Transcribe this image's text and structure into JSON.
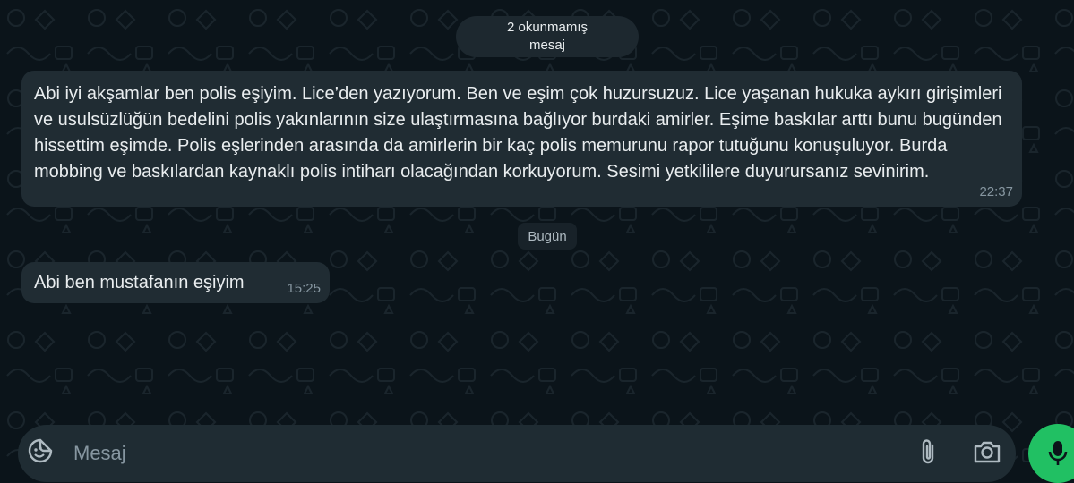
{
  "unread_banner": {
    "line1": "2 okunmamış",
    "line2": "mesaj"
  },
  "messages": [
    {
      "text": "Abi iyi akşamlar ben polis eşiyim. Lice’den yazıyorum. Ben ve eşim çok huzursuzuz. Lice yaşanan hukuka aykırı girişimleri ve usulsüzlüğün bedelini polis yakınlarının size ulaştırmasına bağlıyor burdaki amirler. Eşime baskılar arttı bunu bugünden hissettim eşimde. Polis eşlerinden arasında da amirlerin bir kaç polis memurunu rapor tutuğunu konuşuluyor. Burda mobbing ve baskılardan kaynaklı polis intiharı olacağından korkuyorum. Sesimi yetkililere duyurursanız sevinirim.",
      "time": "22:37"
    },
    {
      "text": "Abi ben mustafanın eşiyim",
      "time": "15:25"
    }
  ],
  "date_separator": "Bugün",
  "composer": {
    "placeholder": "Mesaj"
  },
  "icons": {
    "emoji": "sticker-smile-icon",
    "attach": "paperclip-icon",
    "camera": "camera-icon",
    "mic": "microphone-icon"
  },
  "colors": {
    "background": "#0b141a",
    "bubble": "#202c33",
    "accent": "#21c063"
  }
}
